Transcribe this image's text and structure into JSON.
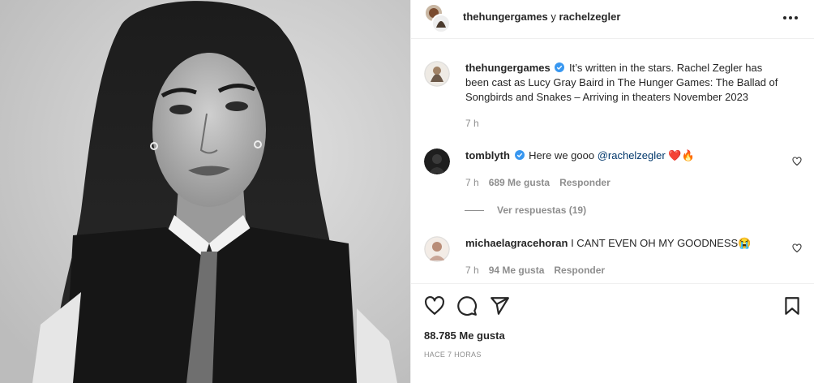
{
  "header": {
    "user1": "thehungergames",
    "conjunction": "y",
    "user2": "rachelzegler",
    "more_icon": "more-horizontal-icon"
  },
  "caption": {
    "username": "thehungergames",
    "text": "It’s written in the stars. Rachel Zegler has been cast as Lucy Gray Baird in The Hunger Games: The Ballad of Songbirds and Snakes – Arriving in theaters November 2023",
    "time": "7 h"
  },
  "comments": [
    {
      "username": "tomblyth",
      "verified": true,
      "text_before": "Here we gooo ",
      "mention": "@rachelzegler",
      "emoji": "❤️🔥",
      "time": "7 h",
      "likes": "689 Me gusta",
      "reply": "Responder"
    },
    {
      "username": "michaelagracehoran",
      "verified": false,
      "text": "I CANT EVEN OH MY GOODNESS",
      "emoji": "😭",
      "time": "7 h",
      "likes": "94 Me gusta",
      "reply": "Responder"
    }
  ],
  "view_replies": "Ver respuestas (19)",
  "actions": {
    "icons": [
      "heart-icon",
      "comment-icon",
      "share-icon",
      "bookmark-icon"
    ],
    "likes": "88.785 Me gusta",
    "timestamp": "HACE 7 HORAS"
  },
  "colors": {
    "text": "#262626",
    "muted": "#8e8e8e",
    "verified": "#3897f0",
    "mention": "#00376b",
    "border": "#efefef"
  }
}
